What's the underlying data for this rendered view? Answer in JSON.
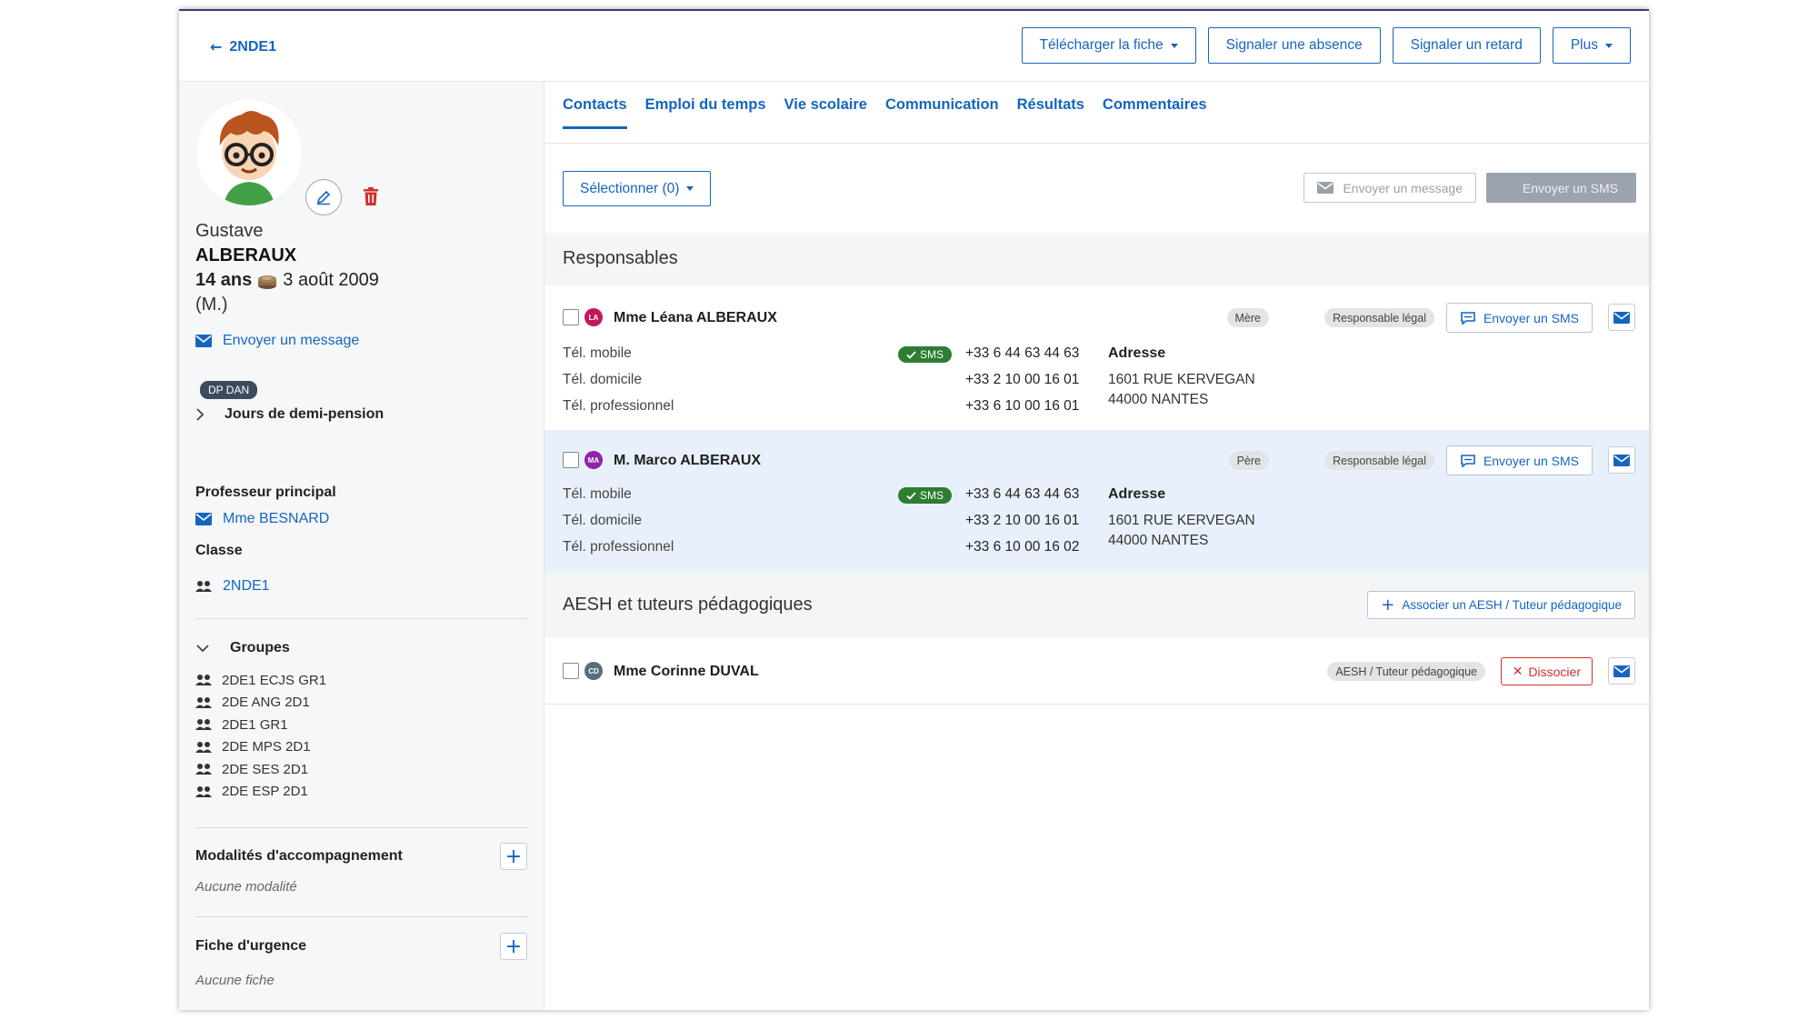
{
  "header": {
    "back_label": "2NDE1",
    "actions": {
      "download": "Télécharger la fiche",
      "absence": "Signaler une absence",
      "delay": "Signaler un retard",
      "more": "Plus"
    }
  },
  "student": {
    "first_name": "Gustave",
    "last_name": "ALBERAUX",
    "age": "14 ans",
    "birthdate": "3 août 2009",
    "gender": "(M.)",
    "message_link": "Envoyer un message",
    "badge": "DP DAN",
    "demi_pension": "Jours de demi-pension"
  },
  "sidebar": {
    "principal_title": "Professeur principal",
    "principal_name": "Mme BESNARD",
    "class_title": "Classe",
    "class_name": "2NDE1",
    "groups_title": "Groupes",
    "groups": [
      "2DE1 ECJS GR1",
      "2DE ANG 2D1",
      "2DE1 GR1",
      "2DE MPS 2D1",
      "2DE SES 2D1",
      "2DE ESP 2D1"
    ],
    "modalites_title": "Modalités d'accompagnement",
    "modalites_empty": "Aucune modalité",
    "urgence_title": "Fiche d'urgence",
    "urgence_empty": "Aucune fiche"
  },
  "tabs": [
    "Contacts",
    "Emploi du temps",
    "Vie scolaire",
    "Communication",
    "Résultats",
    "Commentaires"
  ],
  "toolbar": {
    "select_label": "Sélectionner (0)",
    "send_message": "Envoyer un message",
    "send_sms": "Envoyer un SMS"
  },
  "responsables": {
    "title": "Responsables",
    "contacts": [
      {
        "initials": "LA",
        "name": "Mme Léana ALBERAUX",
        "tags": [
          "Mère",
          "Responsable légal"
        ],
        "sms_button": "Envoyer un SMS",
        "labels": [
          "Tél. mobile",
          "Tél. domicile",
          "Tél. professionnel"
        ],
        "sms_pill": "SMS",
        "phones": [
          "+33 6 44 63 44 63",
          "+33 2 10 00 16 01",
          "+33 6 10 00 16 01"
        ],
        "address_title": "Adresse",
        "address_line1": "1601 RUE KERVEGAN",
        "address_line2": "44000 NANTES"
      },
      {
        "initials": "MA",
        "name": "M. Marco ALBERAUX",
        "tags": [
          "Père",
          "Responsable légal"
        ],
        "sms_button": "Envoyer un SMS",
        "labels": [
          "Tél. mobile",
          "Tél. domicile",
          "Tél. professionnel"
        ],
        "sms_pill": "SMS",
        "phones": [
          "+33 6 44 63 44 63",
          "+33 2 10 00 16 01",
          "+33 6 10 00 16 02"
        ],
        "address_title": "Adresse",
        "address_line1": "1601 RUE KERVEGAN",
        "address_line2": "44000 NANTES"
      }
    ]
  },
  "aesh": {
    "title": "AESH et tuteurs pédagogiques",
    "associate_button": "Associer un AESH / Tuteur pédagogique",
    "contact": {
      "initials": "CD",
      "name": "Mme Corinne DUVAL",
      "tag": "AESH / Tuteur pédagogique",
      "dissociate": "Dissocier"
    }
  },
  "colors": {
    "accent": "#1565c0",
    "sms_green": "#2e7d32",
    "danger": "#d32f2f",
    "highlight_row": "#e8f1fb",
    "avatar_la": "#c2185b",
    "avatar_ma": "#8e24aa",
    "avatar_cd": "#546e7a"
  }
}
